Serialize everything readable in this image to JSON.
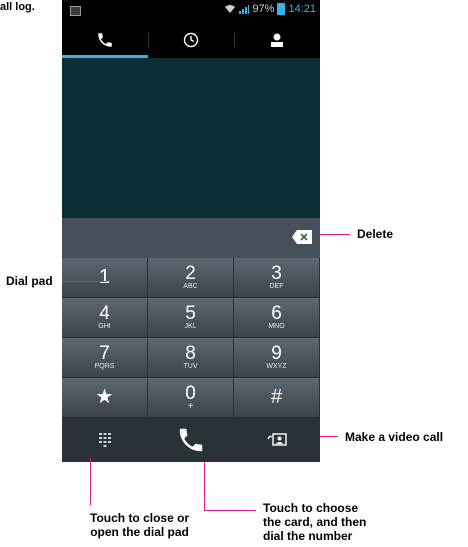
{
  "doc_fragment": "all log.",
  "status_bar": {
    "percent": "97%",
    "time": "14:21"
  },
  "tabs": [
    {
      "name": "dialer",
      "icon": "phone-icon"
    },
    {
      "name": "call-log",
      "icon": "clock-icon"
    },
    {
      "name": "contacts",
      "icon": "person-icon"
    }
  ],
  "keys": [
    {
      "num": "1",
      "letters": ""
    },
    {
      "num": "2",
      "letters": "ABC"
    },
    {
      "num": "3",
      "letters": "DEF"
    },
    {
      "num": "4",
      "letters": "GHI"
    },
    {
      "num": "5",
      "letters": "JKL"
    },
    {
      "num": "6",
      "letters": "MNO"
    },
    {
      "num": "7",
      "letters": "PQRS"
    },
    {
      "num": "8",
      "letters": "TUV"
    },
    {
      "num": "9",
      "letters": "WXYZ"
    },
    {
      "num": "★",
      "letters": ""
    },
    {
      "num": "0",
      "letters": "+"
    },
    {
      "num": "#",
      "letters": ""
    }
  ],
  "annotations": {
    "delete": "Delete",
    "dial_pad": "Dial pad",
    "video_call": "Make a video call",
    "close_pad_1": "Touch to close or",
    "close_pad_2": "open the dial pad",
    "choose_card_1": "Touch to choose",
    "choose_card_2": "the card, and then",
    "choose_card_3": "dial the number"
  },
  "colors": {
    "accent": "#33b5e5",
    "callout_line": "#e61c8c"
  }
}
